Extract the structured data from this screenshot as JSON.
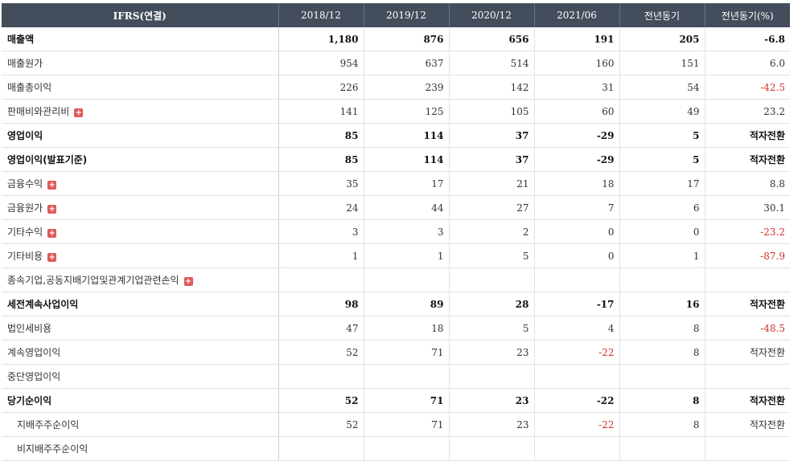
{
  "header": {
    "label_column": "IFRS(연결)",
    "columns": [
      "2018/12",
      "2019/12",
      "2020/12",
      "2021/06",
      "전년동기",
      "전년동기(%)"
    ]
  },
  "rows": [
    {
      "label": "매출액",
      "values": [
        "1,180",
        "876",
        "656",
        "191",
        "205",
        "-6.8"
      ]
    },
    {
      "label": "매출원가",
      "values": [
        "954",
        "637",
        "514",
        "160",
        "151",
        "6.0"
      ]
    },
    {
      "label": "매출총이익",
      "values": [
        "226",
        "239",
        "142",
        "31",
        "54",
        "-42.5"
      ]
    },
    {
      "label": "판매비와관리비",
      "expand_icon": "plus-icon",
      "values": [
        "141",
        "125",
        "105",
        "60",
        "49",
        "23.2"
      ]
    },
    {
      "label": "영업이익",
      "values": [
        "85",
        "114",
        "37",
        "-29",
        "5",
        "적자전환"
      ]
    },
    {
      "label": "영업이익(발표기준)",
      "values": [
        "85",
        "114",
        "37",
        "-29",
        "5",
        "적자전환"
      ]
    },
    {
      "label": "금융수익",
      "expand_icon": "plus-icon",
      "values": [
        "35",
        "17",
        "21",
        "18",
        "17",
        "8.8"
      ]
    },
    {
      "label": "금융원가",
      "expand_icon": "plus-icon",
      "values": [
        "24",
        "44",
        "27",
        "7",
        "6",
        "30.1"
      ]
    },
    {
      "label": "기타수익",
      "expand_icon": "plus-icon",
      "values": [
        "3",
        "3",
        "2",
        "0",
        "0",
        "-23.2"
      ]
    },
    {
      "label": "기타비용",
      "expand_icon": "plus-icon",
      "values": [
        "1",
        "1",
        "5",
        "0",
        "1",
        "-87.9"
      ]
    },
    {
      "label": "종속기업,공동지배기업및관계기업관련손익",
      "expand_icon": "plus-icon",
      "values": [
        "",
        "",
        "",
        "",
        "",
        ""
      ]
    },
    {
      "label": "세전계속사업이익",
      "values": [
        "98",
        "89",
        "28",
        "-17",
        "16",
        "적자전환"
      ]
    },
    {
      "label": "법인세비용",
      "values": [
        "47",
        "18",
        "5",
        "4",
        "8",
        "-48.5"
      ]
    },
    {
      "label": "계속영업이익",
      "values": [
        "52",
        "71",
        "23",
        "-22",
        "8",
        "적자전환"
      ]
    },
    {
      "label": "중단영업이익",
      "values": [
        "",
        "",
        "",
        "",
        "",
        ""
      ]
    },
    {
      "label": "당기순이익",
      "values": [
        "52",
        "71",
        "23",
        "-22",
        "8",
        "적자전환"
      ]
    },
    {
      "label": "지배주주순이익",
      "values": [
        "52",
        "71",
        "23",
        "-22",
        "8",
        "적자전환"
      ]
    },
    {
      "label": "비지배주주순이익",
      "values": [
        "",
        "",
        "",
        "",
        "",
        ""
      ]
    }
  ],
  "colors": {
    "header_bg": "#434d5b",
    "negative": "#d0312d",
    "expand_icon": "#e05a5a"
  }
}
